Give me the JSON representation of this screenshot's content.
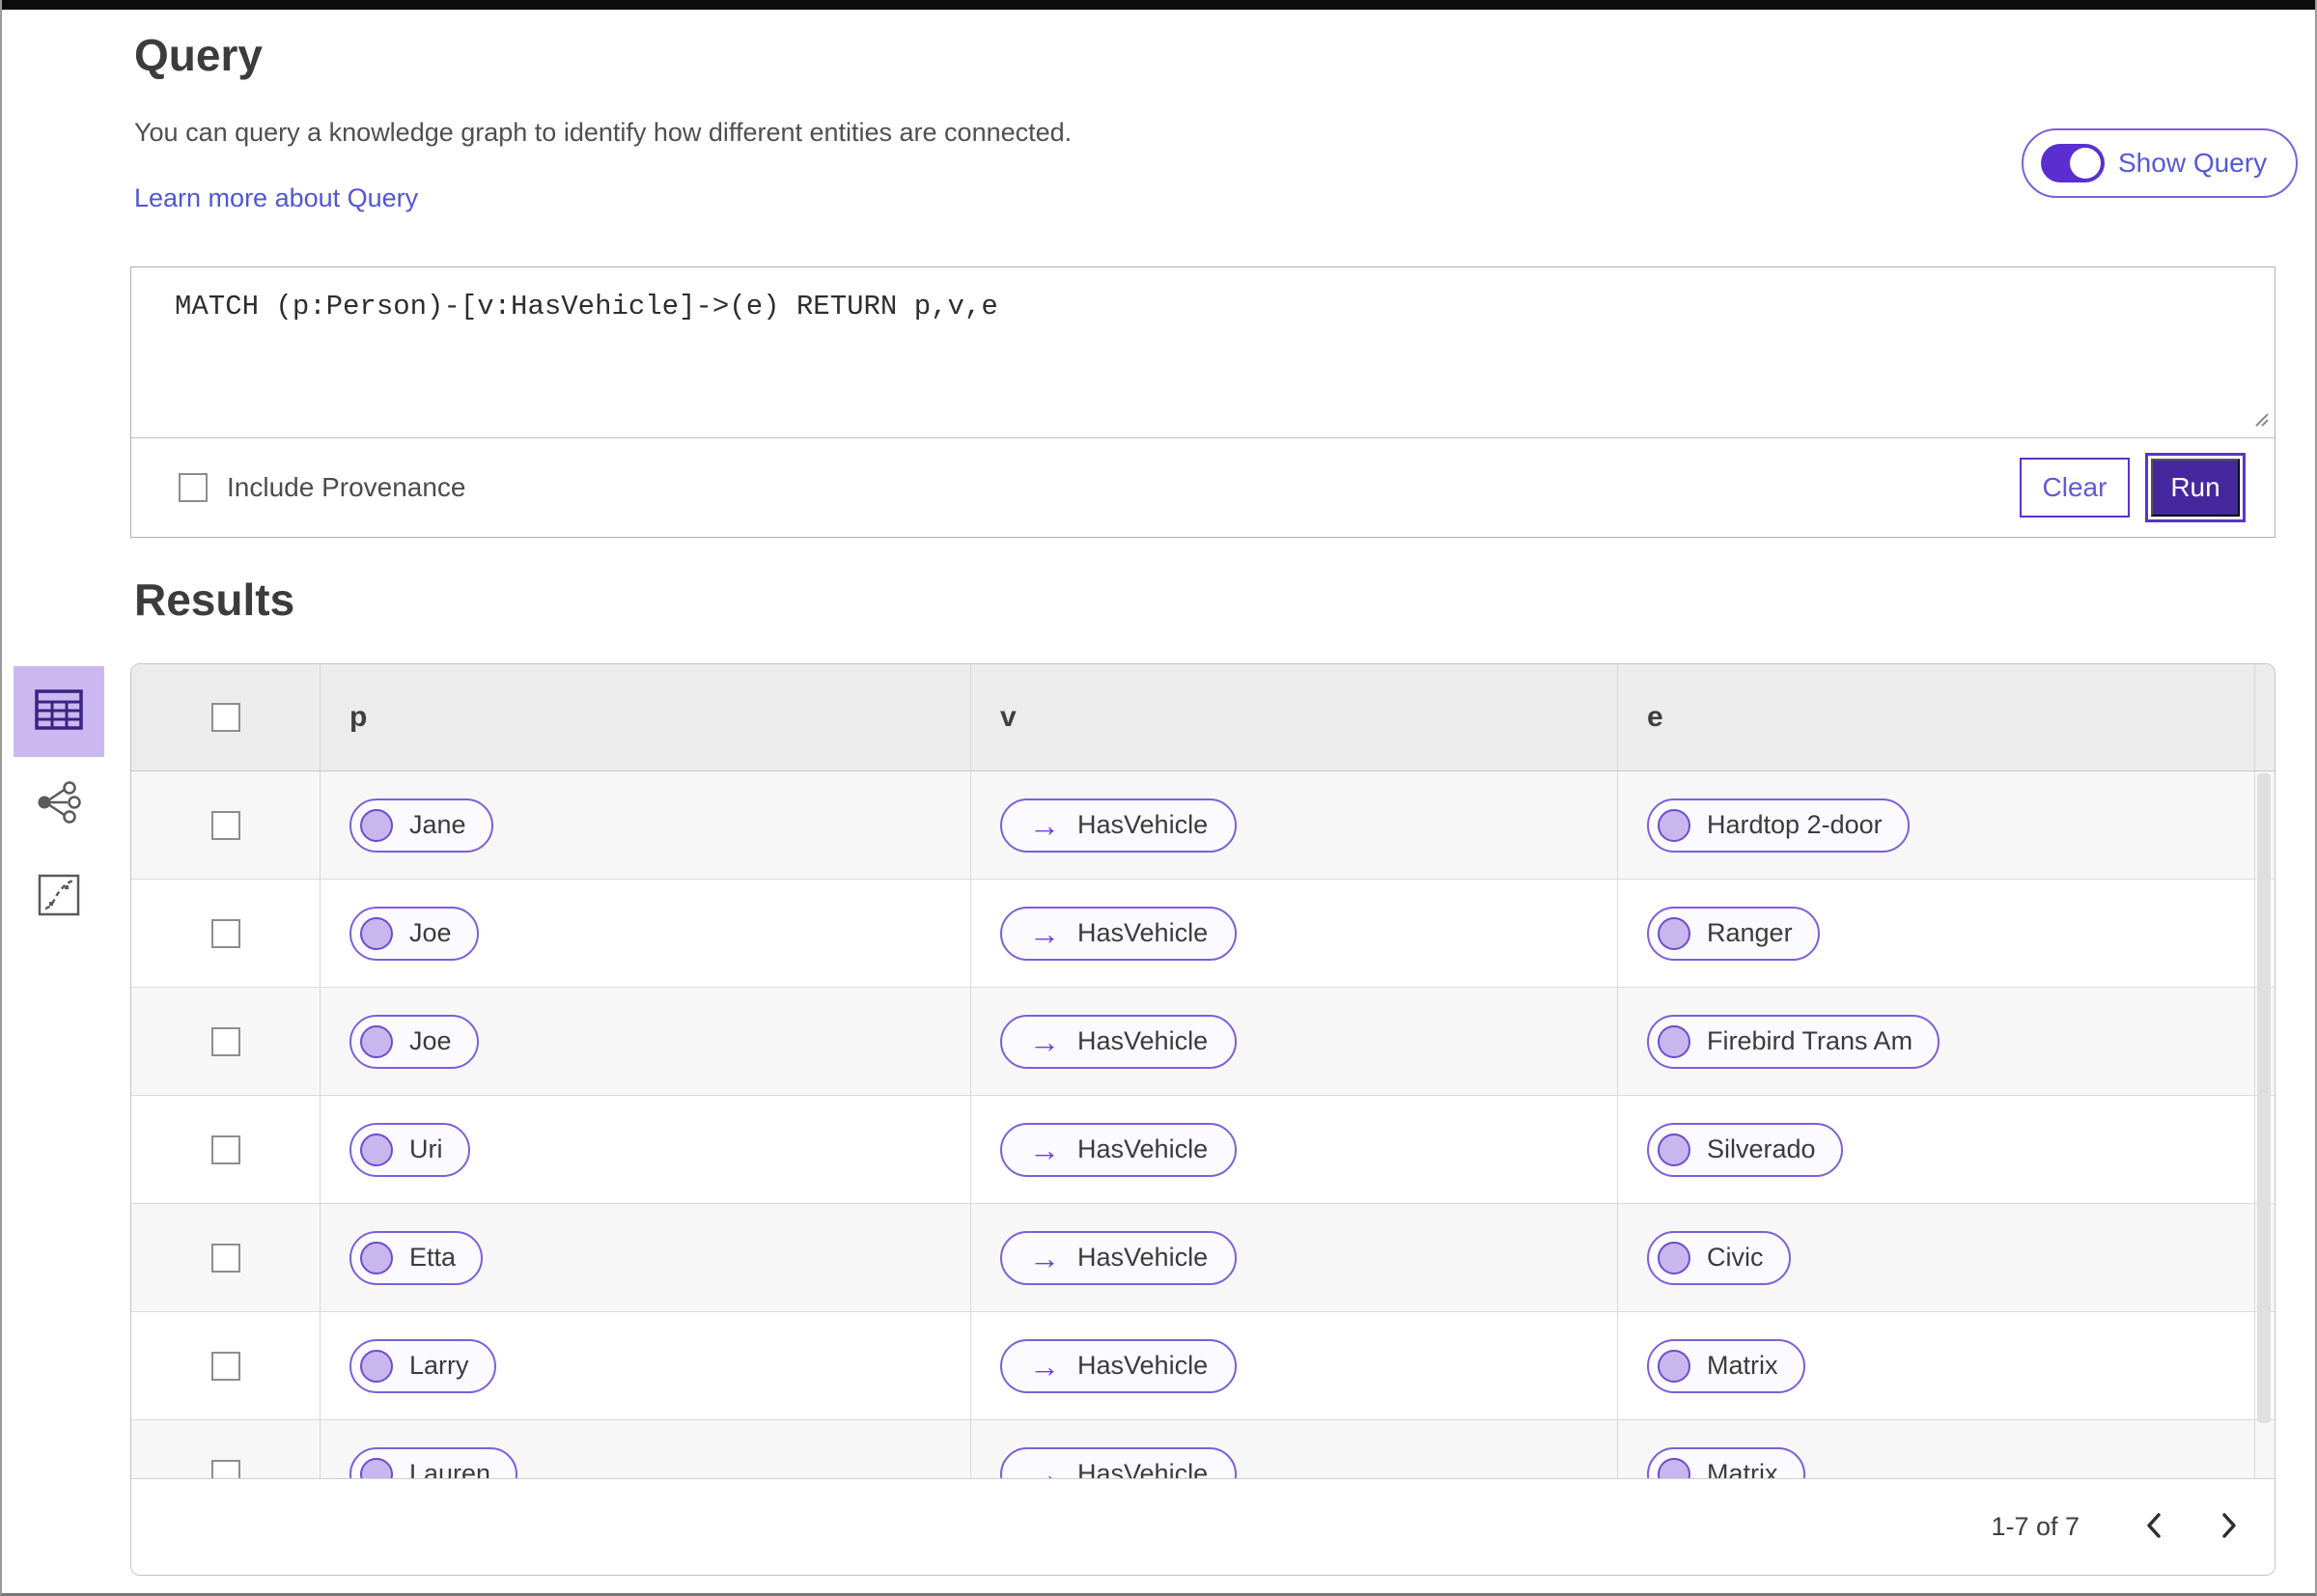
{
  "query_section": {
    "title": "Query",
    "description": "You can query a knowledge graph to identify how different entities are connected.",
    "learn_more_link": "Learn more about Query",
    "show_query_toggle": {
      "label": "Show Query",
      "state": "on"
    },
    "query_input": {
      "value": "MATCH (p:Person)-[v:HasVehicle]->(e) RETURN p,v,e"
    },
    "include_provenance": {
      "label": "Include Provenance",
      "checked": false
    },
    "buttons": {
      "clear": "Clear",
      "run": "Run"
    }
  },
  "results_section": {
    "title": "Results",
    "view_switcher": [
      {
        "label": "Table view",
        "icon": "table-icon",
        "selected": true
      },
      {
        "label": "Graph view",
        "icon": "network-icon",
        "selected": false
      },
      {
        "label": "Chart view",
        "icon": "scatter-chart-icon",
        "selected": false
      }
    ],
    "table": {
      "columns": [
        "p",
        "v",
        "e"
      ],
      "rows": [
        {
          "p": "Jane",
          "v": "HasVehicle",
          "e": "Hardtop 2-door"
        },
        {
          "p": "Joe",
          "v": "HasVehicle",
          "e": "Ranger"
        },
        {
          "p": "Joe",
          "v": "HasVehicle",
          "e": "Firebird Trans Am"
        },
        {
          "p": "Uri",
          "v": "HasVehicle",
          "e": "Silverado"
        },
        {
          "p": "Etta",
          "v": "HasVehicle",
          "e": "Civic"
        },
        {
          "p": "Larry",
          "v": "HasVehicle",
          "e": "Matrix"
        },
        {
          "p": "Lauren",
          "v": "HasVehicle",
          "e": "Matrix"
        }
      ],
      "pagination": {
        "range_label": "1-7 of 7"
      }
    }
  },
  "colors": {
    "accent_purple": "#5b33c9",
    "primary_button_fill": "#46289e",
    "toggle_fill": "#5a2ecf",
    "pill_border": "#7d5fd8",
    "pill_dot_fill": "#c8b7ee",
    "selected_view_bg": "#ccb8f1",
    "link_text": "#5156d4"
  }
}
